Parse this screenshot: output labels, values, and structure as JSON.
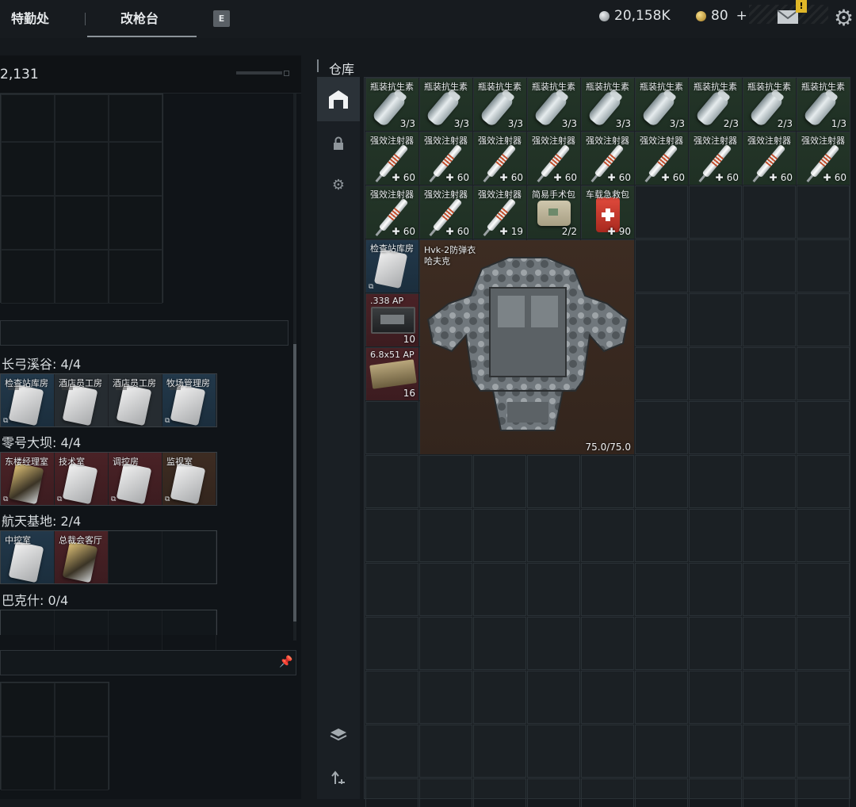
{
  "topbar": {
    "tabs": [
      {
        "label": "特勤处"
      },
      {
        "label": "改枪台"
      }
    ],
    "key_hint": "E",
    "currency_silver": "20,158K",
    "currency_gold": "80",
    "add_label": "+",
    "mail_badge": "!",
    "colors": {
      "silver": "#b9bec2",
      "gold": "#d4a93a",
      "badge": "#e0b728"
    }
  },
  "left_panel": {
    "header_value": "2,131",
    "sections": [
      {
        "title": "长弓溪谷: 4/4",
        "keys": [
          {
            "name": "检查站库房",
            "rarity": "blue"
          },
          {
            "name": "酒店员工房",
            "rarity": "grey"
          },
          {
            "name": "酒店员工房",
            "rarity": "grey"
          },
          {
            "name": "牧场管理房",
            "rarity": "blue"
          }
        ]
      },
      {
        "title": "零号大坝: 4/4",
        "keys": [
          {
            "name": "东楼经理室",
            "rarity": "red"
          },
          {
            "name": "技术室",
            "rarity": "red"
          },
          {
            "name": "调控房",
            "rarity": "red"
          },
          {
            "name": "监视室",
            "rarity": "brown"
          }
        ]
      },
      {
        "title": "航天基地: 2/4",
        "keys": [
          {
            "name": "中控室",
            "rarity": "blue"
          },
          {
            "name": "总裁会客厅",
            "rarity": "red"
          }
        ]
      },
      {
        "title": "巴克什: 0/4",
        "keys": []
      }
    ]
  },
  "warehouse": {
    "title": "仓库",
    "nav_icons": [
      "warehouse-icon",
      "lock-icon",
      "gear-icon",
      "layers-icon",
      "sort-icon"
    ],
    "rows": [
      [
        {
          "name": "瓶装抗生素",
          "count": "3/3",
          "type": "can"
        },
        {
          "name": "瓶装抗生素",
          "count": "3/3",
          "type": "can"
        },
        {
          "name": "瓶装抗生素",
          "count": "3/3",
          "type": "can"
        },
        {
          "name": "瓶装抗生素",
          "count": "3/3",
          "type": "can"
        },
        {
          "name": "瓶装抗生素",
          "count": "3/3",
          "type": "can"
        },
        {
          "name": "瓶装抗生素",
          "count": "3/3",
          "type": "can"
        },
        {
          "name": "瓶装抗生素",
          "count": "2/3",
          "type": "can"
        },
        {
          "name": "瓶装抗生素",
          "count": "2/3",
          "type": "can"
        },
        {
          "name": "瓶装抗生素",
          "count": "1/3",
          "type": "can"
        }
      ],
      [
        {
          "name": "强效注射器",
          "count": "60",
          "type": "syringe"
        },
        {
          "name": "强效注射器",
          "count": "60",
          "type": "syringe"
        },
        {
          "name": "强效注射器",
          "count": "60",
          "type": "syringe"
        },
        {
          "name": "强效注射器",
          "count": "60",
          "type": "syringe"
        },
        {
          "name": "强效注射器",
          "count": "60",
          "type": "syringe"
        },
        {
          "name": "强效注射器",
          "count": "60",
          "type": "syringe"
        },
        {
          "name": "强效注射器",
          "count": "60",
          "type": "syringe"
        },
        {
          "name": "强效注射器",
          "count": "60",
          "type": "syringe"
        },
        {
          "name": "强效注射器",
          "count": "60",
          "type": "syringe"
        }
      ],
      [
        {
          "name": "强效注射器",
          "count": "60",
          "type": "syringe"
        },
        {
          "name": "强效注射器",
          "count": "60",
          "type": "syringe"
        },
        {
          "name": "强效注射器",
          "count": "19",
          "type": "syringe"
        },
        {
          "name": "简易手术包",
          "count": "2/2",
          "type": "surgbag"
        },
        {
          "name": "车载急救包",
          "count": "90",
          "type": "medkit"
        }
      ]
    ],
    "small_items": [
      {
        "name": "检查站库房",
        "count": "",
        "type": "key",
        "rarity": "blue"
      },
      {
        "name": ".338 AP",
        "count": "10",
        "type": "ammo",
        "rarity": "red"
      },
      {
        "name": "6.8x51 AP",
        "count": "16",
        "type": "ammo2",
        "rarity": "red"
      }
    ],
    "armor": {
      "name": "Hvk-2防弹衣",
      "subname": "哈夫克",
      "durability": "75.0/75.0",
      "rarity": "brown"
    }
  }
}
